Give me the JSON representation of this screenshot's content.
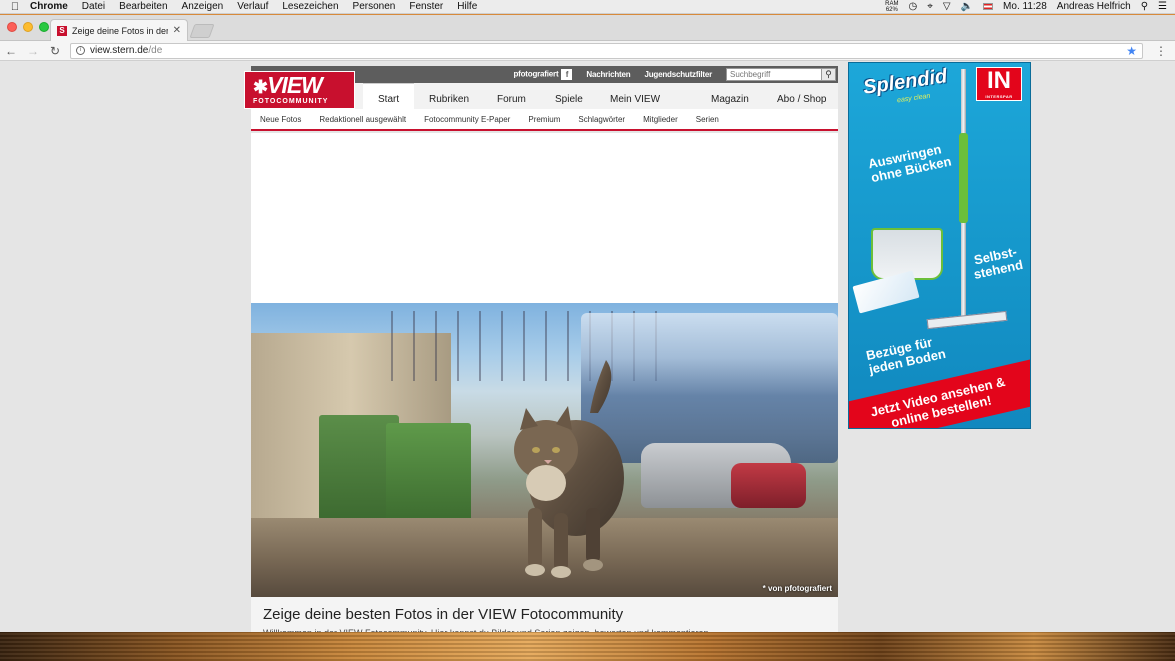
{
  "menubar": {
    "app": "Chrome",
    "items": [
      "Datei",
      "Bearbeiten",
      "Anzeigen",
      "Verlauf",
      "Lesezeichen",
      "Personen",
      "Fenster",
      "Hilfe"
    ],
    "ram_label": "RAM",
    "ram_value": "62%",
    "clock": "Mo. 11:28",
    "user": "Andreas Helfrich"
  },
  "tab": {
    "title": "Zeige deine Fotos in der VIEW",
    "favicon": "S"
  },
  "address": {
    "host": "view.stern.de",
    "path": "/de"
  },
  "site": {
    "topbar": {
      "pfotografiert": "pfotografiert",
      "fb_icon": "f",
      "nachrichten": "Nachrichten",
      "jugendschutz": "Jugendschutzfilter",
      "search_placeholder": "Suchbegriff"
    },
    "logo": {
      "main": "VIEW",
      "sub": "FOTOCOMMUNITY"
    },
    "mainnav": [
      "Start",
      "Rubriken",
      "Forum",
      "Spiele",
      "Mein VIEW",
      "Magazin",
      "Abo / Shop"
    ],
    "subnav": [
      "Neue Fotos",
      "Redaktionell ausgewählt",
      "Fotocommunity E-Paper",
      "Premium",
      "Schlagwörter",
      "Mitglieder",
      "Serien"
    ],
    "hero_credit": "* von pfotografiert",
    "article_title": "Zeige deine besten Fotos in der VIEW Fotocommunity",
    "article_lead": "Willkommen in der VIEW Fotocommunity. Hier kannst du Bilder und Serien zeigen, bewerten und kommentieren."
  },
  "ad": {
    "brand": "Splendid",
    "brand_sub": "easy clean",
    "badge": "IN",
    "badge_sub": "INTERSPAR",
    "line1": [
      "Auswringen",
      "ohne Bücken"
    ],
    "line2": [
      "Selbst-",
      "stehend"
    ],
    "line3": [
      "Bezüge für",
      "jeden Boden"
    ],
    "cta": [
      "Jetzt Video ansehen &",
      "online bestellen!"
    ]
  },
  "colors": {
    "brand_red": "#c8102e",
    "topbar_gray": "#5d5d5d",
    "ad_blue": "#1da7d9"
  }
}
